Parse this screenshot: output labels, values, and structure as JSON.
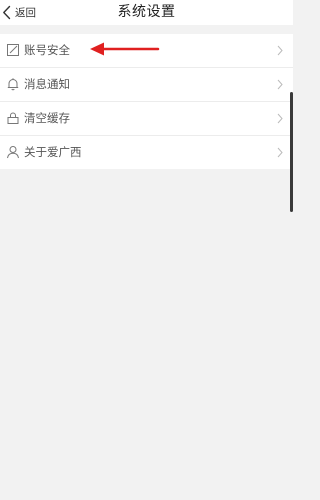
{
  "header": {
    "back_label": "返回",
    "title": "系统设置"
  },
  "settings": {
    "items": [
      {
        "label": "账号安全",
        "icon": "edit-icon"
      },
      {
        "label": "消息通知",
        "icon": "bell-icon"
      },
      {
        "label": "清空缓存",
        "icon": "lock-icon"
      },
      {
        "label": "关于爱广西",
        "icon": "user-icon"
      }
    ]
  },
  "colors": {
    "background": "#f2f2f2",
    "list_background": "#ffffff",
    "annotation_arrow": "#e02020"
  }
}
